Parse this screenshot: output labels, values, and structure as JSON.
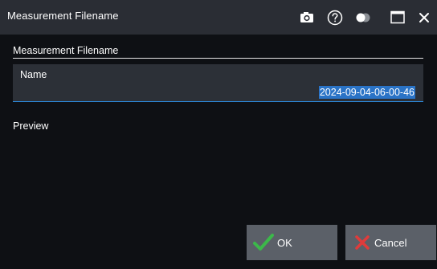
{
  "dialog": {
    "title": "Measurement Filename",
    "section_label": "Measurement Filename",
    "name_field": {
      "label": "Name",
      "value": "2024-09-04-06-00-46",
      "selected": true
    },
    "preview_label": "Preview",
    "buttons": {
      "ok_label": "OK",
      "cancel_label": "Cancel"
    }
  },
  "titlebar_icons": [
    "camera-icon",
    "help-icon",
    "toggle-icon",
    "maximize-icon",
    "close-icon"
  ],
  "colors": {
    "titlebar_bg": "#2a2d34",
    "dialog_bg": "#0e1014",
    "field_bg": "#2c3037",
    "accent": "#2b86d6",
    "selection": "#2a73c6",
    "button_bg": "#5b6068",
    "ok_check": "#3cb84a",
    "cancel_x": "#e03b3b"
  }
}
